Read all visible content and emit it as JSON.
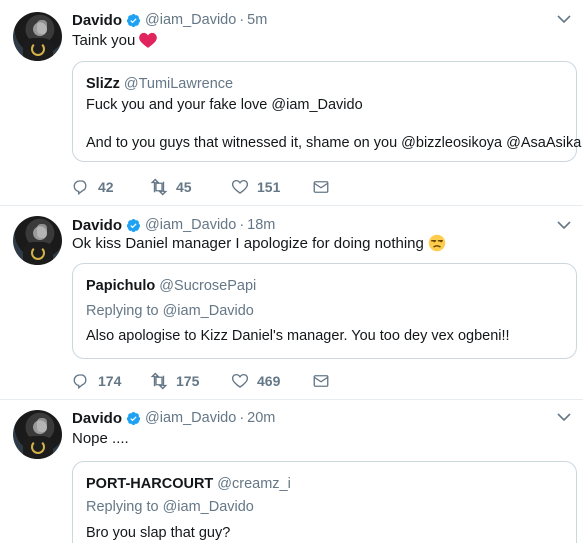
{
  "tweets": [
    {
      "name": "Davido",
      "handle": "@iam_Davido",
      "dot": "·",
      "time": "5m",
      "text": "Taink you",
      "emoji": "red-heart",
      "quote": {
        "name": "SliZz",
        "handle": "@TumiLawrence",
        "replying_to": "",
        "lines": [
          "Fuck you and your fake love @iam_Davido",
          "And to you guys that witnessed it, shame on you @bizzleosikoya @AsaAsika"
        ]
      },
      "replies": "42",
      "retweets": "45",
      "likes": "151"
    },
    {
      "name": "Davido",
      "handle": "@iam_Davido",
      "dot": "·",
      "time": "18m",
      "text": "Ok kiss Daniel manager I apologize for doing nothing",
      "emoji": "unamused-face",
      "quote": {
        "name": "Papichulo",
        "handle": "@SucrosePapi",
        "replying_to": "Replying to @iam_Davido",
        "lines": [
          "Also apologise to Kizz Daniel's manager. You too dey vex ogbeni!!"
        ]
      },
      "replies": "174",
      "retweets": "175",
      "likes": "469"
    },
    {
      "name": "Davido",
      "handle": "@iam_Davido",
      "dot": "·",
      "time": "20m",
      "text": "Nope ....",
      "quote": {
        "name": "PORT-HARCOURT",
        "handle": "@creamz_i",
        "replying_to": "Replying to @iam_Davido",
        "lines": [
          "Bro you slap that guy?"
        ]
      }
    }
  ],
  "colors": {
    "verified": "#1da1f2",
    "secondary_text": "#657786",
    "heart": "#e0245e",
    "border": "#e6ecf0"
  },
  "icons": [
    "verified-badge-icon",
    "chevron-down-icon",
    "reply-icon",
    "retweet-icon",
    "like-icon",
    "message-icon"
  ]
}
